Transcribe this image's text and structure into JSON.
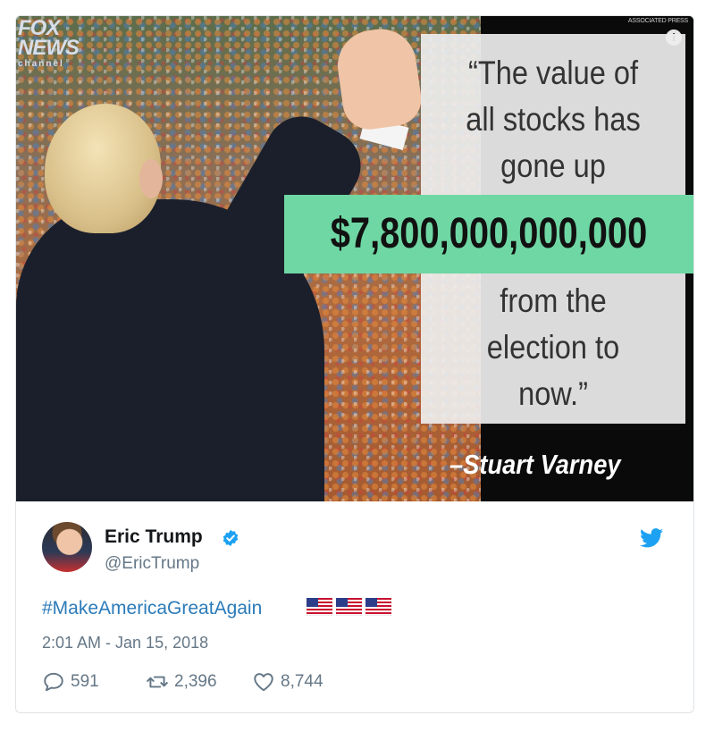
{
  "image": {
    "logo_line1": "FOX",
    "logo_line2": "NEWS",
    "logo_line3": "channel",
    "credit": "ASSOCIATED PRESS",
    "quote_top": [
      "“The value of",
      "all stocks has",
      "gone up"
    ],
    "amount": "$7,800,000,000,000",
    "quote_bottom": [
      "from the",
      "election to",
      "now.”"
    ],
    "attribution": "–Stuart Varney",
    "info_icon": "info-icon"
  },
  "tweet": {
    "display_name": "Eric Trump",
    "verified_icon": "verified-badge-icon",
    "handle": "@EricTrump",
    "hashtag": "#MakeAmericaGreatAgain",
    "flag_icons": [
      "us-flag-icon",
      "us-flag-icon",
      "us-flag-icon"
    ],
    "timestamp": "2:01 AM - Jan 15, 2018",
    "replies": "591",
    "retweets": "2,396",
    "likes": "8,744",
    "colors": {
      "link": "#2b7bb9",
      "muted": "#657786",
      "twitter_blue": "#1da1f2",
      "highlight": "#6fd7a4"
    }
  }
}
